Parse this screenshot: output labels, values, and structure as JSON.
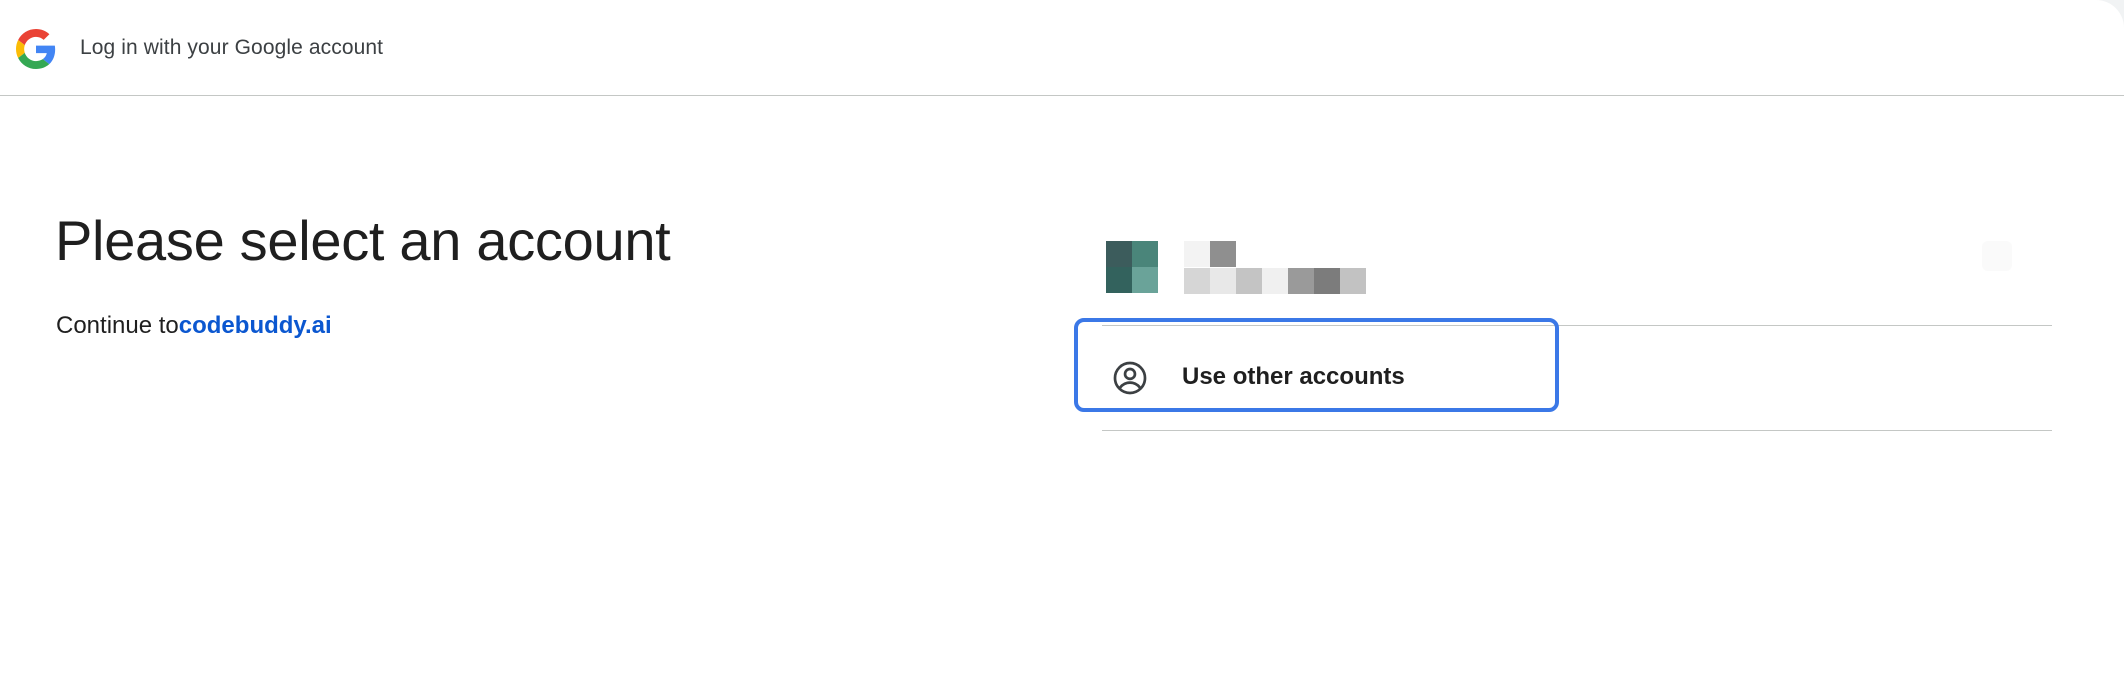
{
  "header": {
    "logo_icon": "google-g-icon",
    "title": "Log in with your Google account"
  },
  "main": {
    "title": "Please select an account",
    "continue_prefix": "Continue to",
    "continue_link": "codebuddy.ai"
  },
  "accounts": {
    "items": [
      {
        "avatar": "pixelated-avatar",
        "name_redacted": true
      }
    ],
    "use_other": {
      "icon": "account-circle-icon",
      "label": "Use other accounts"
    }
  },
  "colors": {
    "link": "#0b57d0",
    "highlight": "#3b78e7",
    "divider": "#c4c7c5",
    "text": "#1f1f1f"
  }
}
